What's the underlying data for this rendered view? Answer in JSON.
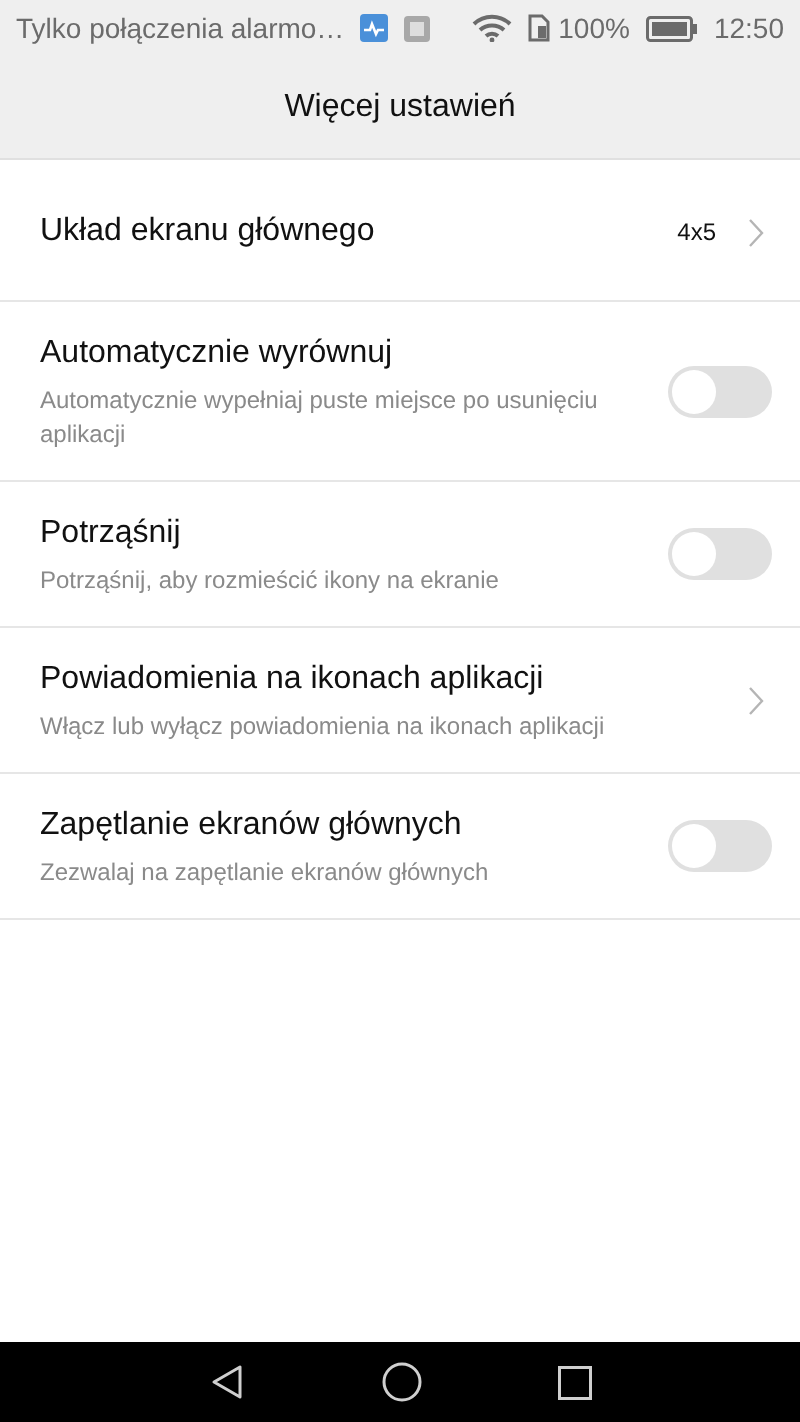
{
  "status_bar": {
    "carrier": "Tylko połączenia alarmo…",
    "battery": "100%",
    "time": "12:50"
  },
  "header": {
    "title": "Więcej ustawień"
  },
  "settings": [
    {
      "kind": "link",
      "title": "Układ ekranu głównego",
      "value": "4x5"
    },
    {
      "kind": "toggle",
      "title": "Automatycznie wyrównuj",
      "subtitle": "Automatycznie wypełniaj puste miejsce po usunięciu aplikacji",
      "on": false
    },
    {
      "kind": "toggle",
      "title": "Potrząśnij",
      "subtitle": "Potrząśnij, aby rozmieścić ikony na ekranie",
      "on": false
    },
    {
      "kind": "link",
      "title": "Powiadomienia na ikonach aplikacji",
      "subtitle": "Włącz lub wyłącz powiadomienia na ikonach aplikacji"
    },
    {
      "kind": "toggle",
      "title": "Zapętlanie ekranów głównych",
      "subtitle": "Zezwalaj na zapętlanie ekranów głównych",
      "on": false
    }
  ]
}
